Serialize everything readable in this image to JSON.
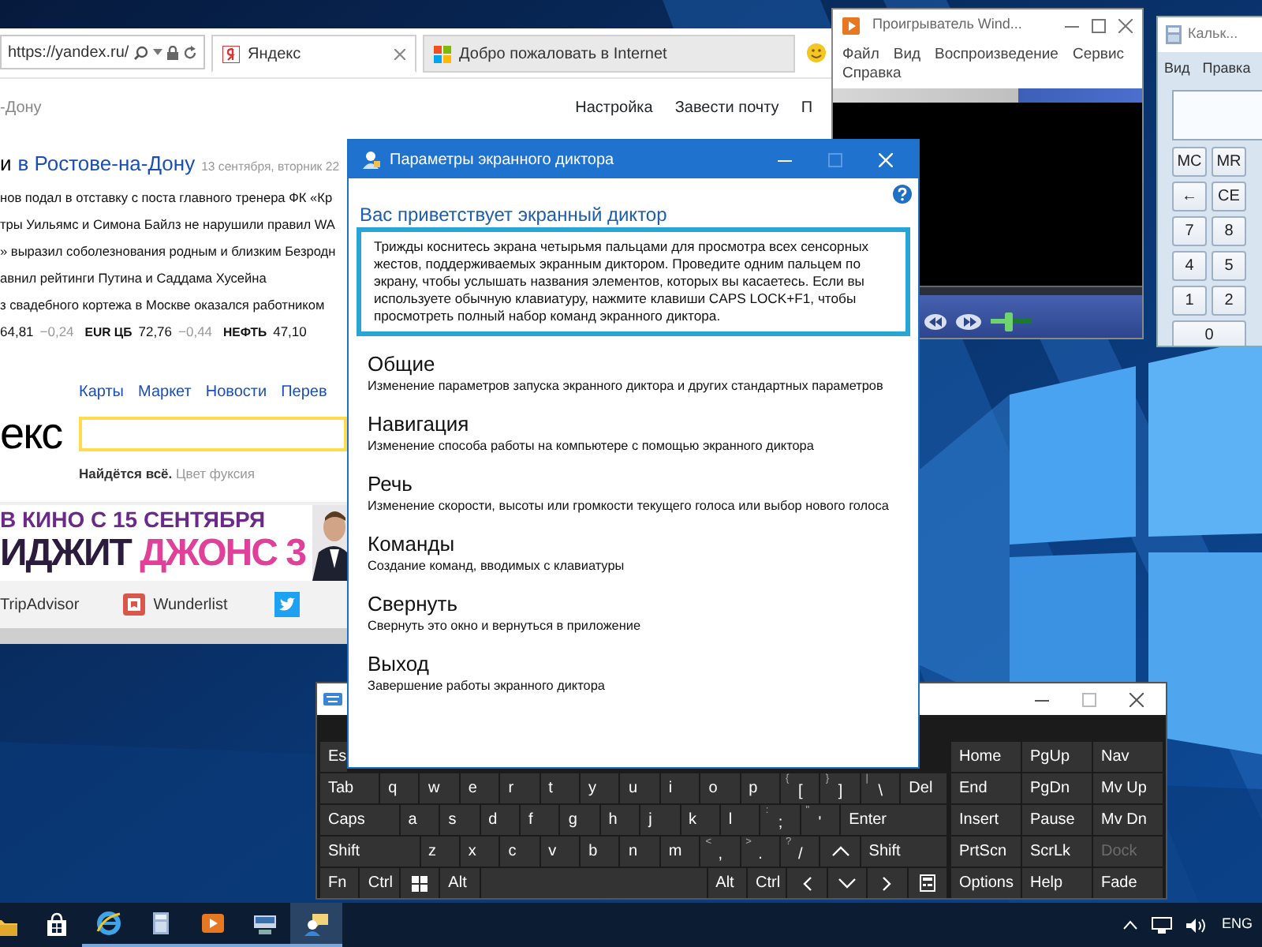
{
  "browser": {
    "address": "https://yandex.ru/",
    "tabs": [
      {
        "label": "Яндекс",
        "selected": true
      },
      {
        "label": "Добро пожаловать в Internet",
        "selected": false
      }
    ],
    "region": "-Дону",
    "header_links": [
      "Настройка",
      "Завести почту",
      "П"
    ],
    "headline": {
      "lead": "и",
      "city": "в Ростове-на-Дону",
      "date": "13 сентября, вторник 22"
    },
    "news": [
      "нов подал в отставку с поста главного тренера ФК «Кр",
      "тры Уильямс и Симона Байлз не нарушили правил WA",
      "» выразил соболезнования родным и близким Безродн",
      "авнил рейтинги Путина и Саддама Хусейна",
      "з свадебного кортежа в Москве оказался работником"
    ],
    "rates": [
      {
        "value": "64,81",
        "change": "−0,24"
      },
      {
        "label": "EUR ЦБ",
        "value": "72,76",
        "change": "−0,44"
      },
      {
        "label": "НЕФТЬ",
        "value": "47,10"
      }
    ],
    "services": [
      "Карты",
      "Маркет",
      "Новости",
      "Перев"
    ],
    "logo": "екс",
    "search_hint": {
      "lead": "Найдётся всё.",
      "example": "Цвет фуксия"
    },
    "banner": {
      "line_1": "В КИНО С 15 СЕНТЯБРЯ",
      "line_2": "ИДЖИТ",
      "line_2_accent": "ДЖОНС 3"
    },
    "apps": [
      {
        "label": "TripAdvisor",
        "kind": "text"
      },
      {
        "label": "Wunderlist",
        "kind": "wunderlist"
      },
      {
        "kind": "twitter"
      }
    ]
  },
  "media_player": {
    "title": "Проигрыватель Wind...",
    "menu": [
      "Файл",
      "Вид",
      "Воспроизведение",
      "Сервис",
      "Справка"
    ],
    "volume": {
      "level": 0.45
    }
  },
  "calculator": {
    "title": "Кальк...",
    "menu": [
      "Вид",
      "Правка"
    ],
    "keys": [
      [
        "MC",
        "MR"
      ],
      [
        "←",
        "CE"
      ],
      [
        "7",
        "8"
      ],
      [
        "4",
        "5"
      ],
      [
        "1",
        "2"
      ],
      [
        "0"
      ]
    ]
  },
  "narrator": {
    "title": "Параметры экранного диктора",
    "welcome": "Вас приветствует экранный диктор",
    "intro": "Трижды коснитесь экрана четырьмя пальцами для просмотра всех сенсорных жестов, поддерживаемых экранным диктором. Проведите одним пальцем по экрану, чтобы услышать названия элементов, которых вы касаетесь. Если вы используете обычную клавиатуру, нажмите клавиши CAPS LOCK+F1, чтобы просмотреть полный набор команд экранного диктора.",
    "sections": [
      {
        "title": "Общие",
        "description": "Изменение параметров запуска экранного диктора и других стандартных параметров"
      },
      {
        "title": "Навигация",
        "description": "Изменение способа работы на компьютере с помощью экранного диктора"
      },
      {
        "title": "Речь",
        "description": "Изменение скорости, высоты или громкости текущего голоса или выбор нового голоса"
      },
      {
        "title": "Команды",
        "description": "Создание команд, вводимых с клавиатуры"
      },
      {
        "title": "Свернуть",
        "description": "Свернуть это окно и вернуться в приложение"
      },
      {
        "title": "Выход",
        "description": "Завершение работы экранного диктора"
      }
    ]
  },
  "keyboard": {
    "main_rows": [
      [
        {
          "label": "Es",
          "kind": "stub"
        }
      ],
      [
        {
          "label": "Tab",
          "kind": "wide"
        },
        {
          "label": "q",
          "kind": "key"
        },
        {
          "label": "w",
          "kind": "key"
        },
        {
          "label": "e",
          "kind": "key"
        },
        {
          "label": "r",
          "kind": "key"
        },
        {
          "label": "t",
          "kind": "key"
        },
        {
          "label": "y",
          "kind": "key"
        },
        {
          "label": "u",
          "kind": "key"
        },
        {
          "label": "i",
          "kind": "key"
        },
        {
          "label": "o",
          "kind": "key"
        },
        {
          "label": "p",
          "kind": "key"
        },
        {
          "label": "[",
          "shift": "{",
          "kind": "key"
        },
        {
          "label": "]",
          "shift": "}",
          "kind": "key"
        },
        {
          "label": "\\",
          "shift": "|",
          "kind": "key"
        },
        {
          "label": "Del",
          "kind": "fill"
        }
      ],
      [
        {
          "label": "Caps",
          "kind": "wider"
        },
        {
          "label": "a",
          "kind": "key"
        },
        {
          "label": "s",
          "kind": "key"
        },
        {
          "label": "d",
          "kind": "key"
        },
        {
          "label": "f",
          "kind": "key"
        },
        {
          "label": "g",
          "kind": "key"
        },
        {
          "label": "h",
          "kind": "key"
        },
        {
          "label": "j",
          "kind": "key"
        },
        {
          "label": "k",
          "kind": "key"
        },
        {
          "label": "l",
          "kind": "key"
        },
        {
          "label": ";",
          "shift": ":",
          "kind": "key"
        },
        {
          "label": "'",
          "shift": "\"",
          "kind": "key"
        },
        {
          "label": "Enter",
          "kind": "fill"
        }
      ],
      [
        {
          "label": "Shift",
          "kind": "widest"
        },
        {
          "label": "z",
          "kind": "key"
        },
        {
          "label": "x",
          "kind": "key"
        },
        {
          "label": "c",
          "kind": "key"
        },
        {
          "label": "v",
          "kind": "key"
        },
        {
          "label": "b",
          "kind": "key"
        },
        {
          "label": "n",
          "kind": "key"
        },
        {
          "label": "m",
          "kind": "key"
        },
        {
          "label": ",",
          "shift": "<",
          "kind": "key"
        },
        {
          "label": ".",
          "shift": ">",
          "kind": "key"
        },
        {
          "label": "/",
          "shift": "?",
          "kind": "key"
        },
        {
          "kind": "arrow-up"
        },
        {
          "label": "Shift",
          "kind": "fill"
        }
      ],
      [
        {
          "label": "Fn",
          "kind": "key"
        },
        {
          "label": "Ctrl",
          "kind": "key"
        },
        {
          "kind": "windows"
        },
        {
          "label": "Alt",
          "kind": "key"
        },
        {
          "kind": "space"
        },
        {
          "label": "Alt",
          "kind": "key"
        },
        {
          "label": "Ctrl",
          "kind": "key"
        },
        {
          "kind": "arrow-left"
        },
        {
          "kind": "arrow-down"
        },
        {
          "kind": "arrow-right"
        },
        {
          "kind": "keyboard"
        }
      ]
    ],
    "side_rows": [
      [
        {
          "label": "Home",
          "disabled": false
        },
        {
          "label": "PgUp",
          "disabled": false
        },
        {
          "label": "Nav",
          "disabled": false
        }
      ],
      [
        {
          "label": "End",
          "disabled": false
        },
        {
          "label": "PgDn",
          "disabled": false
        },
        {
          "label": "Mv Up",
          "disabled": false
        }
      ],
      [
        {
          "label": "Insert",
          "disabled": false
        },
        {
          "label": "Pause",
          "disabled": false
        },
        {
          "label": "Mv Dn",
          "disabled": false
        }
      ],
      [
        {
          "label": "PrtScn",
          "disabled": false
        },
        {
          "label": "ScrLk",
          "disabled": false
        },
        {
          "label": "Dock",
          "disabled": true
        }
      ],
      [
        {
          "label": "Options",
          "disabled": false
        },
        {
          "label": "Help",
          "disabled": false
        },
        {
          "label": "Fade",
          "disabled": false
        }
      ]
    ]
  },
  "taskbar": {
    "items": [
      {
        "kind": "folder",
        "running": false,
        "selected": false
      },
      {
        "kind": "store",
        "running": false,
        "selected": false
      },
      {
        "kind": "browser",
        "running": true,
        "selected": false
      },
      {
        "kind": "calculator",
        "running": true,
        "selected": false
      },
      {
        "kind": "media",
        "running": true,
        "selected": false
      },
      {
        "kind": "keyboard",
        "running": true,
        "selected": false
      },
      {
        "kind": "narrator",
        "running": true,
        "selected": true
      }
    ],
    "language": "ENG"
  }
}
